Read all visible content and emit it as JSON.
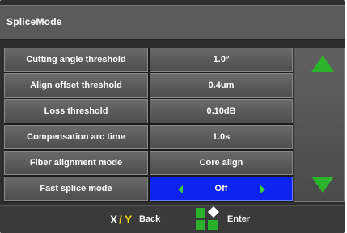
{
  "window": {
    "title": "SpliceMode"
  },
  "settings": [
    {
      "label": "Cutting angle threshold",
      "value": "1.0°"
    },
    {
      "label": "Align offset threshold",
      "value": "0.4um"
    },
    {
      "label": "Loss threshold",
      "value": "0.10dB"
    },
    {
      "label": "Compensation arc  time",
      "value": "1.0s"
    },
    {
      "label": "Fiber alignment mode",
      "value": "Core align"
    },
    {
      "label": "Fast splice mode",
      "value": "Off",
      "selected": true
    }
  ],
  "footer": {
    "back_key_x": "X",
    "back_key_slash": "/",
    "back_key_y": "Y",
    "back_label": "Back",
    "enter_label": "Enter"
  },
  "icons": {
    "scroll_up": "triangle-up-icon",
    "scroll_down": "triangle-down-icon",
    "value_prev": "arrow-left-icon",
    "value_next": "arrow-right-icon",
    "enter": "enter-key-icon"
  },
  "colors": {
    "selected_value_bg": "#0f23f0",
    "arrow_green": "#2db42d",
    "key_yellow": "#f2d200"
  }
}
